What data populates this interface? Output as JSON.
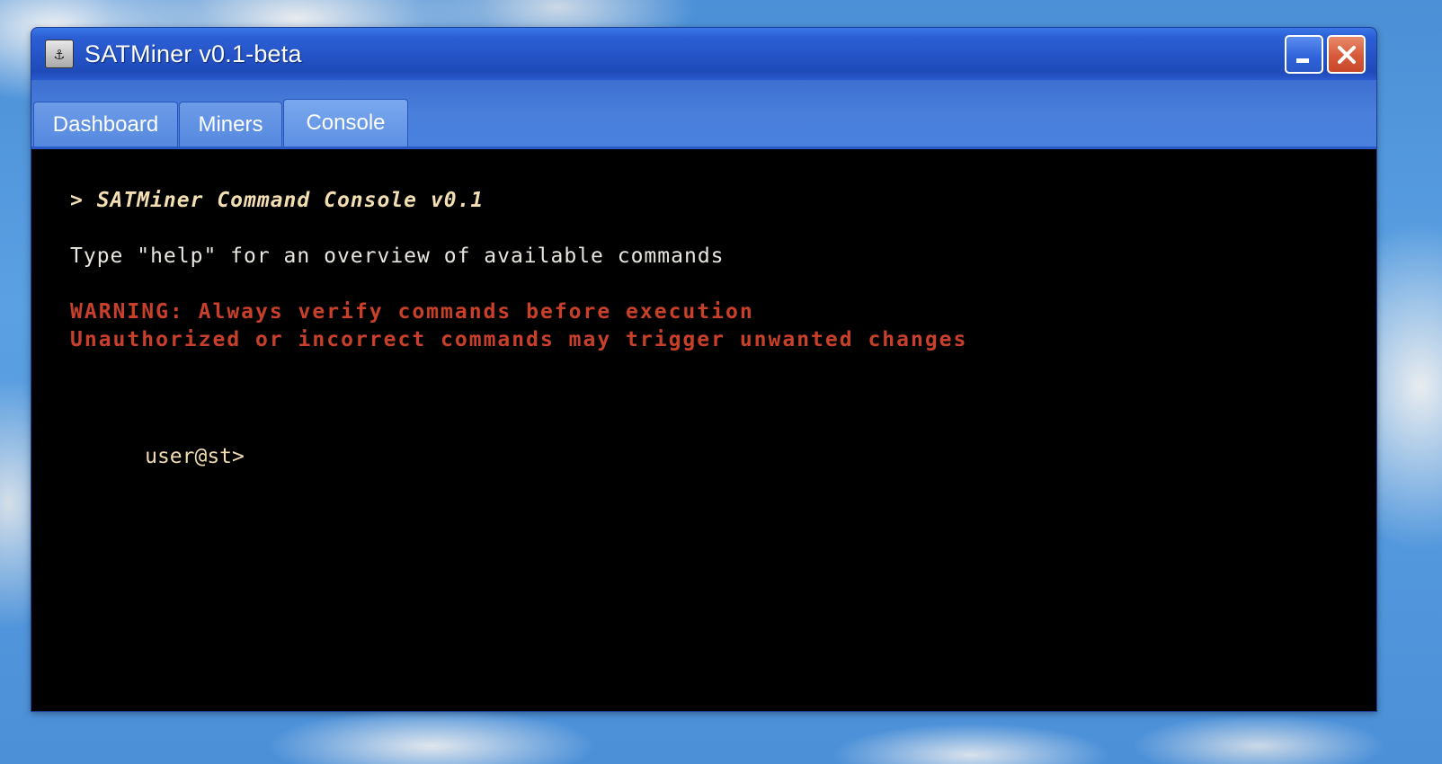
{
  "window": {
    "title": "SATMiner v0.1-beta",
    "icon": "app-logo-icon",
    "controls": {
      "minimize_icon": "minimize-icon",
      "close_icon": "close-icon"
    }
  },
  "tabs": [
    {
      "label": "Dashboard",
      "active": false
    },
    {
      "label": "Miners",
      "active": false
    },
    {
      "label": "Console",
      "active": true
    }
  ],
  "console": {
    "header": "> SATMiner Command Console v0.1",
    "info": "Type \"help\" for an overview of available commands",
    "warning_line_1": "WARNING: Always verify commands before execution",
    "warning_line_2": "Unauthorized or incorrect commands may trigger unwanted changes",
    "prompt": "user@st>",
    "input_value": ""
  },
  "colors": {
    "console_background": "#000000",
    "header_text": "#f3dfb2",
    "info_text": "#e8e6df",
    "warning_text": "#c9402a",
    "titlebar": "#2453c6"
  }
}
